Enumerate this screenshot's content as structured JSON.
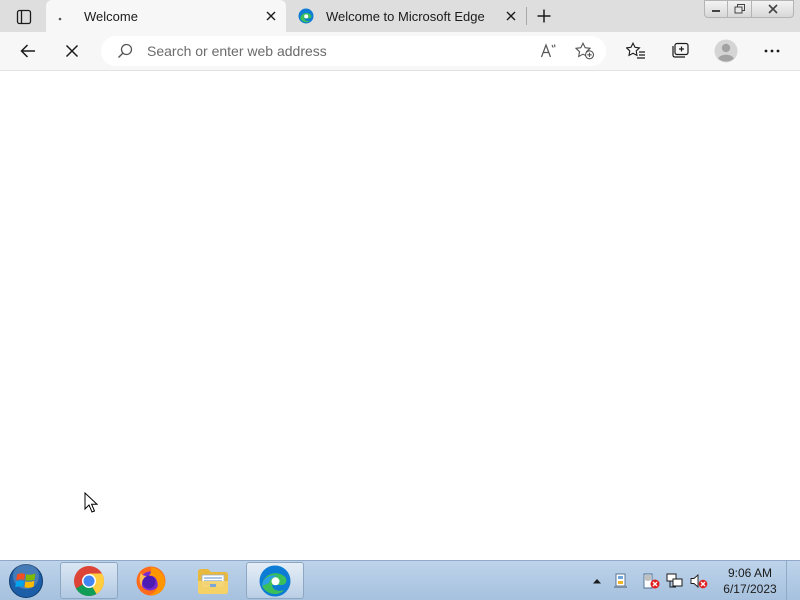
{
  "browser": {
    "tabs": [
      {
        "title": "Welcome",
        "active": true,
        "favicon": "loading-dot-icon",
        "close_icon": "close-icon"
      },
      {
        "title": "Welcome to Microsoft Edge",
        "active": false,
        "favicon": "edge-logo-icon",
        "close_icon": "close-icon"
      }
    ],
    "tab_actions_icon": "tab-actions-icon",
    "new_tab_icon": "plus-icon",
    "window_controls": [
      "minimize-icon",
      "restore-icon",
      "close-icon"
    ]
  },
  "toolbar": {
    "back_icon": "back-arrow-icon",
    "stop_icon": "stop-loading-icon",
    "address": {
      "value": "",
      "placeholder": "Search or enter web address",
      "search_icon": "search-icon",
      "read_aloud_icon": "read-aloud-icon",
      "add_favorite_icon": "add-favorite-icon"
    },
    "favorites_icon": "favorites-icon",
    "collections_icon": "collections-icon",
    "profile_icon": "profile-avatar-icon",
    "menu_icon": "more-icon"
  },
  "taskbar": {
    "start_icon": "windows-start-icon",
    "apps": [
      {
        "name": "Google Chrome",
        "icon": "chrome-icon"
      },
      {
        "name": "Firefox",
        "icon": "firefox-icon"
      },
      {
        "name": "File Explorer",
        "icon": "folder-icon"
      },
      {
        "name": "Microsoft Edge",
        "icon": "edge-logo-icon"
      }
    ],
    "tray_icons": [
      "show-hidden-icons-icon",
      "network-device-icon",
      "action-center-error-icon",
      "network-icon",
      "volume-muted-icon"
    ],
    "clock": {
      "time": "9:06 AM",
      "date": "6/17/2023"
    }
  },
  "colors": {
    "tabstrip_bg": "#dedede",
    "toolbar_bg": "#f7f7f7",
    "taskbar_bg": "#bdd3ea",
    "edge_blue": "#0c7cd5",
    "edge_green": "#3bbf5b"
  }
}
